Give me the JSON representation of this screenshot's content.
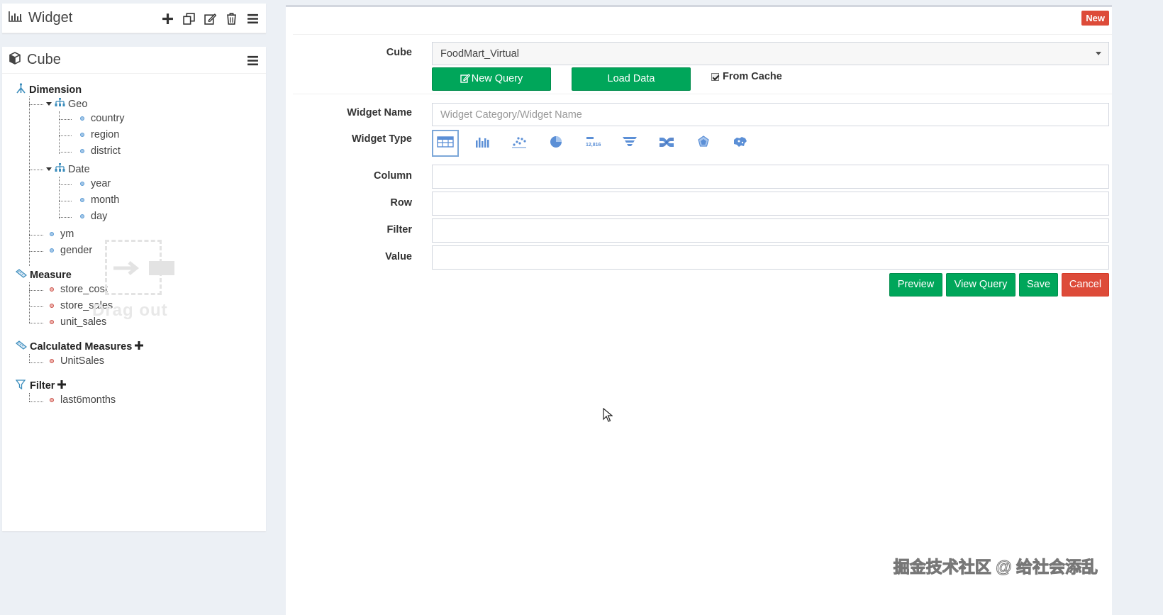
{
  "widget_panel": {
    "title": "Widget"
  },
  "cube_panel": {
    "title": "Cube"
  },
  "tree": {
    "dimension": {
      "label": "Dimension",
      "geo": {
        "label": "Geo",
        "children": [
          "country",
          "region",
          "district"
        ]
      },
      "date": {
        "label": "Date",
        "children": [
          "year",
          "month",
          "day"
        ]
      },
      "leaves": [
        "ym",
        "gender"
      ]
    },
    "measure": {
      "label": "Measure",
      "children": [
        "store_cost",
        "store_sales",
        "unit_sales"
      ]
    },
    "calculated": {
      "label": "Calculated Measures",
      "children": [
        "UnitSales"
      ]
    },
    "filter": {
      "label": "Filter",
      "children": [
        "last6months"
      ]
    }
  },
  "drag_out": {
    "text": "Drag out"
  },
  "editor": {
    "badge": "New",
    "cube_label": "Cube",
    "cube_value": "FoodMart_Virtual",
    "new_query": "New Query",
    "load_data": "Load Data",
    "from_cache": "From Cache",
    "widget_name_label": "Widget Name",
    "widget_name_placeholder": "Widget Category/Widget Name",
    "widget_type_label": "Widget Type",
    "column_label": "Column",
    "row_label": "Row",
    "filter_label": "Filter",
    "value_label": "Value",
    "preview": "Preview",
    "view_query": "View Query",
    "save": "Save",
    "cancel": "Cancel"
  },
  "widget_types": [
    "table",
    "bar",
    "scatter",
    "pie",
    "kpi",
    "funnel",
    "sankey",
    "radar",
    "map"
  ],
  "watermark": "掘金技术社区 @ 给社会添乱",
  "colors": {
    "green": "#00a65a",
    "red": "#dd4b39",
    "tree_blue": "#3c8dbc"
  }
}
